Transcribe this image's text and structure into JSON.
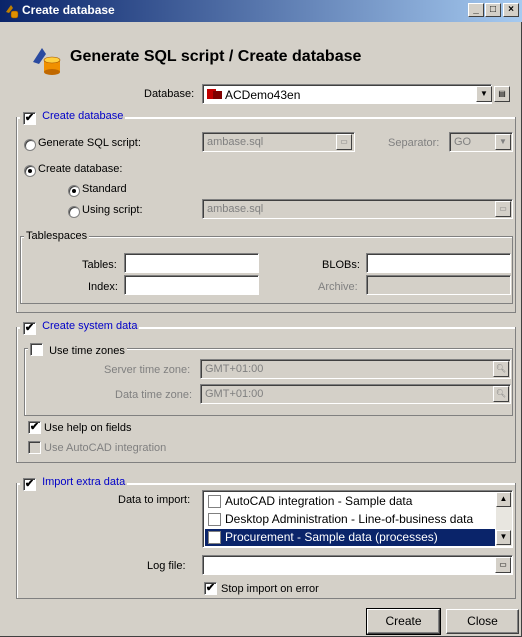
{
  "window": {
    "title": "Create database",
    "min": "_",
    "max": "□",
    "close": "×"
  },
  "header": {
    "title": "Generate SQL script / Create database"
  },
  "database": {
    "label": "Database:",
    "value": "ACDemo43en"
  },
  "create_db": {
    "label": "Create database",
    "generate_sql": {
      "label": "Generate SQL script:",
      "file": "ambase.sql",
      "separator_label": "Separator:",
      "separator_value": "GO"
    },
    "create": {
      "label": "Create database:",
      "standard": "Standard",
      "using_script": "Using script:",
      "script_file": "ambase.sql"
    },
    "tablespaces": {
      "label": "Tablespaces",
      "tables": "Tables:",
      "index": "Index:",
      "blobs": "BLOBs:",
      "archive": "Archive:"
    }
  },
  "system_data": {
    "label": "Create system data",
    "time_zones": {
      "label": "Use time zones",
      "server_label": "Server time zone:",
      "server_value": "GMT+01:00",
      "data_label": "Data time zone:",
      "data_value": "GMT+01:00"
    },
    "help_fields": "Use help on fields",
    "autocad": "Use AutoCAD integration"
  },
  "import": {
    "label": "Import extra data",
    "data_label": "Data to import:",
    "items": [
      "AutoCAD integration - Sample data",
      "Desktop Administration -  Line-of-business data",
      "Procurement -  Sample data (processes)"
    ],
    "log_label": "Log file:",
    "stop_label": "Stop import on error"
  },
  "buttons": {
    "create": "Create",
    "close": "Close"
  }
}
